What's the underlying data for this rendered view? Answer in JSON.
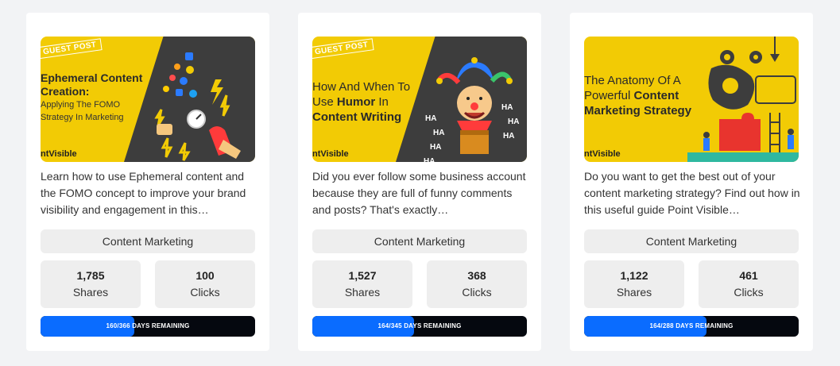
{
  "cards": [
    {
      "tag": "GUEST POST",
      "headline_bold": "Ephemeral Content Creation:",
      "headline_rest": "Applying The FOMO Strategy In Marketing",
      "logo": "ntVisible",
      "description": "Learn how to use Ephemeral content and the FOMO concept to improve your brand visibility and engagement in this…",
      "category": "Content Marketing",
      "shares_value": "1,785",
      "shares_label": "Shares",
      "clicks_value": "100",
      "clicks_label": "Clicks",
      "progress_text": "160/366 DAYS REMAINING",
      "progress_fraction": 0.437
    },
    {
      "tag": "GUEST POST",
      "headline_pre": "How And When To Use",
      "headline_bold": "Humor",
      "headline_mid": "In",
      "headline_bold2": "Content Writing",
      "logo": "ntVisible",
      "description": "Did you ever follow some business account because they are full of funny comments and posts? That's exactly…",
      "category": "Content Marketing",
      "shares_value": "1,527",
      "shares_label": "Shares",
      "clicks_value": "368",
      "clicks_label": "Clicks",
      "progress_text": "164/345 DAYS REMAINING",
      "progress_fraction": 0.475,
      "laughs": [
        "HA",
        "HA",
        "HA",
        "HA",
        "HA",
        "HA",
        "HA"
      ]
    },
    {
      "headline_pre": "The Anatomy Of A Powerful",
      "headline_bold": "Content Marketing Strategy",
      "logo": "ntVisible",
      "description": "Do you want to get the best out of your content marketing strategy? Find out how in this useful guide Point Visible…",
      "category": "Content Marketing",
      "shares_value": "1,122",
      "shares_label": "Shares",
      "clicks_value": "461",
      "clicks_label": "Clicks",
      "progress_text": "164/288 DAYS REMAINING",
      "progress_fraction": 0.569
    }
  ],
  "colors": {
    "background": "#f2f3f5",
    "thumb_yellow": "#f2cb05",
    "thumb_dark": "#3d3d3d",
    "chip": "#eeeeee",
    "progress_fill": "#0a6cff",
    "progress_track": "#05080f"
  }
}
